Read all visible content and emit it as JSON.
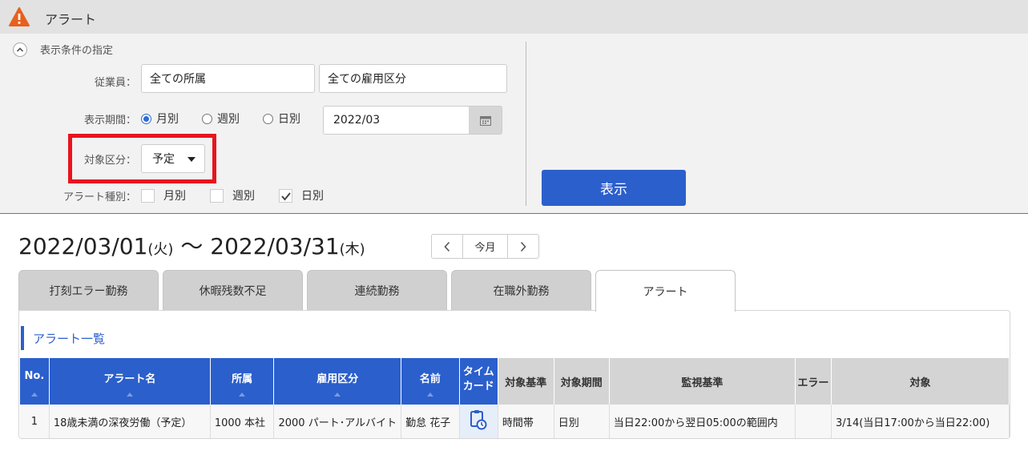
{
  "header": {
    "title": "アラート",
    "icon": "warning-icon",
    "icon_color": "#e8601c"
  },
  "filter": {
    "section_label": "表示条件の指定",
    "employee_label": "従業員：",
    "affiliation_value": "全ての所属",
    "employment_value": "全ての雇用区分",
    "period_label": "表示期間：",
    "period_options": [
      "月別",
      "週別",
      "日別"
    ],
    "period_selected": "月別",
    "period_value": "2022/03",
    "target_label": "対象区分：",
    "target_value": "予定",
    "alert_type_label": "アラート種別：",
    "alert_types": [
      {
        "label": "月別",
        "checked": false
      },
      {
        "label": "週別",
        "checked": false
      },
      {
        "label": "日別",
        "checked": true
      }
    ],
    "show_button": "表示"
  },
  "range": {
    "start": "2022/03/01",
    "start_dow": "(火)",
    "sep": "〜",
    "end": "2022/03/31",
    "end_dow": "(木)",
    "this_month": "今月"
  },
  "tabs": [
    "打刻エラー勤務",
    "休暇残数不足",
    "連続勤務",
    "在職外勤務",
    "アラート"
  ],
  "active_tab": "アラート",
  "list": {
    "title": "アラート一覧",
    "columns": [
      "No.",
      "アラート名",
      "所属",
      "雇用区分",
      "名前",
      "タイム\nカード",
      "対象基準",
      "対象期間",
      "監視基準",
      "エラー",
      "対象"
    ],
    "rows": [
      {
        "no": "1",
        "name": "18歳未満の深夜労働（予定）",
        "affiliation": "1000 本社",
        "employment": "2000 パート･アルバイト",
        "person": "勤怠 花子",
        "basis": "時間帯",
        "period": "日別",
        "criteria": "当日22:00から翌日05:00の範囲内",
        "error": "",
        "target": "3/14(当日17:00から当日22:00)"
      }
    ]
  },
  "colors": {
    "accent": "#2b5fcc",
    "highlight": "#e8141d"
  }
}
